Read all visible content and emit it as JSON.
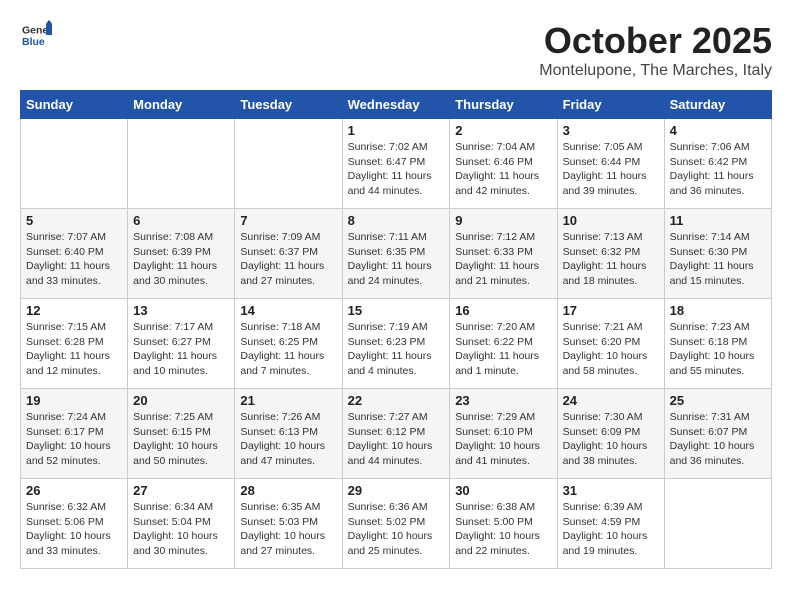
{
  "header": {
    "logo_general": "General",
    "logo_blue": "Blue",
    "month": "October 2025",
    "location": "Montelupone, The Marches, Italy"
  },
  "weekdays": [
    "Sunday",
    "Monday",
    "Tuesday",
    "Wednesday",
    "Thursday",
    "Friday",
    "Saturday"
  ],
  "weeks": [
    [
      {
        "day": "",
        "info": ""
      },
      {
        "day": "",
        "info": ""
      },
      {
        "day": "",
        "info": ""
      },
      {
        "day": "1",
        "info": "Sunrise: 7:02 AM\nSunset: 6:47 PM\nDaylight: 11 hours\nand 44 minutes."
      },
      {
        "day": "2",
        "info": "Sunrise: 7:04 AM\nSunset: 6:46 PM\nDaylight: 11 hours\nand 42 minutes."
      },
      {
        "day": "3",
        "info": "Sunrise: 7:05 AM\nSunset: 6:44 PM\nDaylight: 11 hours\nand 39 minutes."
      },
      {
        "day": "4",
        "info": "Sunrise: 7:06 AM\nSunset: 6:42 PM\nDaylight: 11 hours\nand 36 minutes."
      }
    ],
    [
      {
        "day": "5",
        "info": "Sunrise: 7:07 AM\nSunset: 6:40 PM\nDaylight: 11 hours\nand 33 minutes."
      },
      {
        "day": "6",
        "info": "Sunrise: 7:08 AM\nSunset: 6:39 PM\nDaylight: 11 hours\nand 30 minutes."
      },
      {
        "day": "7",
        "info": "Sunrise: 7:09 AM\nSunset: 6:37 PM\nDaylight: 11 hours\nand 27 minutes."
      },
      {
        "day": "8",
        "info": "Sunrise: 7:11 AM\nSunset: 6:35 PM\nDaylight: 11 hours\nand 24 minutes."
      },
      {
        "day": "9",
        "info": "Sunrise: 7:12 AM\nSunset: 6:33 PM\nDaylight: 11 hours\nand 21 minutes."
      },
      {
        "day": "10",
        "info": "Sunrise: 7:13 AM\nSunset: 6:32 PM\nDaylight: 11 hours\nand 18 minutes."
      },
      {
        "day": "11",
        "info": "Sunrise: 7:14 AM\nSunset: 6:30 PM\nDaylight: 11 hours\nand 15 minutes."
      }
    ],
    [
      {
        "day": "12",
        "info": "Sunrise: 7:15 AM\nSunset: 6:28 PM\nDaylight: 11 hours\nand 12 minutes."
      },
      {
        "day": "13",
        "info": "Sunrise: 7:17 AM\nSunset: 6:27 PM\nDaylight: 11 hours\nand 10 minutes."
      },
      {
        "day": "14",
        "info": "Sunrise: 7:18 AM\nSunset: 6:25 PM\nDaylight: 11 hours\nand 7 minutes."
      },
      {
        "day": "15",
        "info": "Sunrise: 7:19 AM\nSunset: 6:23 PM\nDaylight: 11 hours\nand 4 minutes."
      },
      {
        "day": "16",
        "info": "Sunrise: 7:20 AM\nSunset: 6:22 PM\nDaylight: 11 hours\nand 1 minute."
      },
      {
        "day": "17",
        "info": "Sunrise: 7:21 AM\nSunset: 6:20 PM\nDaylight: 10 hours\nand 58 minutes."
      },
      {
        "day": "18",
        "info": "Sunrise: 7:23 AM\nSunset: 6:18 PM\nDaylight: 10 hours\nand 55 minutes."
      }
    ],
    [
      {
        "day": "19",
        "info": "Sunrise: 7:24 AM\nSunset: 6:17 PM\nDaylight: 10 hours\nand 52 minutes."
      },
      {
        "day": "20",
        "info": "Sunrise: 7:25 AM\nSunset: 6:15 PM\nDaylight: 10 hours\nand 50 minutes."
      },
      {
        "day": "21",
        "info": "Sunrise: 7:26 AM\nSunset: 6:13 PM\nDaylight: 10 hours\nand 47 minutes."
      },
      {
        "day": "22",
        "info": "Sunrise: 7:27 AM\nSunset: 6:12 PM\nDaylight: 10 hours\nand 44 minutes."
      },
      {
        "day": "23",
        "info": "Sunrise: 7:29 AM\nSunset: 6:10 PM\nDaylight: 10 hours\nand 41 minutes."
      },
      {
        "day": "24",
        "info": "Sunrise: 7:30 AM\nSunset: 6:09 PM\nDaylight: 10 hours\nand 38 minutes."
      },
      {
        "day": "25",
        "info": "Sunrise: 7:31 AM\nSunset: 6:07 PM\nDaylight: 10 hours\nand 36 minutes."
      }
    ],
    [
      {
        "day": "26",
        "info": "Sunrise: 6:32 AM\nSunset: 5:06 PM\nDaylight: 10 hours\nand 33 minutes."
      },
      {
        "day": "27",
        "info": "Sunrise: 6:34 AM\nSunset: 5:04 PM\nDaylight: 10 hours\nand 30 minutes."
      },
      {
        "day": "28",
        "info": "Sunrise: 6:35 AM\nSunset: 5:03 PM\nDaylight: 10 hours\nand 27 minutes."
      },
      {
        "day": "29",
        "info": "Sunrise: 6:36 AM\nSunset: 5:02 PM\nDaylight: 10 hours\nand 25 minutes."
      },
      {
        "day": "30",
        "info": "Sunrise: 6:38 AM\nSunset: 5:00 PM\nDaylight: 10 hours\nand 22 minutes."
      },
      {
        "day": "31",
        "info": "Sunrise: 6:39 AM\nSunset: 4:59 PM\nDaylight: 10 hours\nand 19 minutes."
      },
      {
        "day": "",
        "info": ""
      }
    ]
  ]
}
